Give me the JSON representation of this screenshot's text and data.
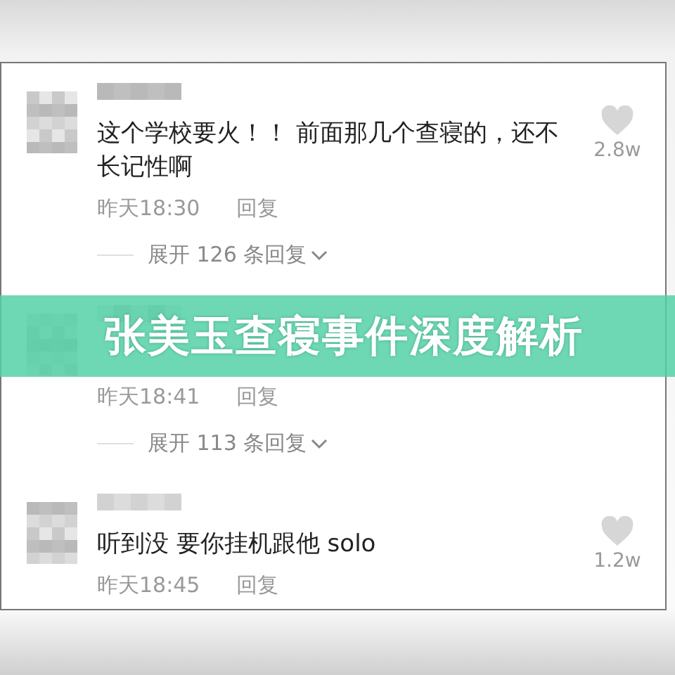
{
  "comments": [
    {
      "text": "这个学校要火！！ 前面那几个查寝的，还不长记性啊",
      "likes": "2.8w",
      "time": "昨天18:30",
      "reply": "回复",
      "expand": "展开 126 条回复"
    },
    {
      "time": "昨天18:41",
      "reply": "回复",
      "expand": "展开 113 条回复"
    },
    {
      "text": "听到没 要你挂机跟他 solo",
      "likes": "1.2w",
      "time": "昨天18:45",
      "reply": "回复"
    }
  ],
  "banner": {
    "title": "张美玉查寝事件深度解析"
  }
}
